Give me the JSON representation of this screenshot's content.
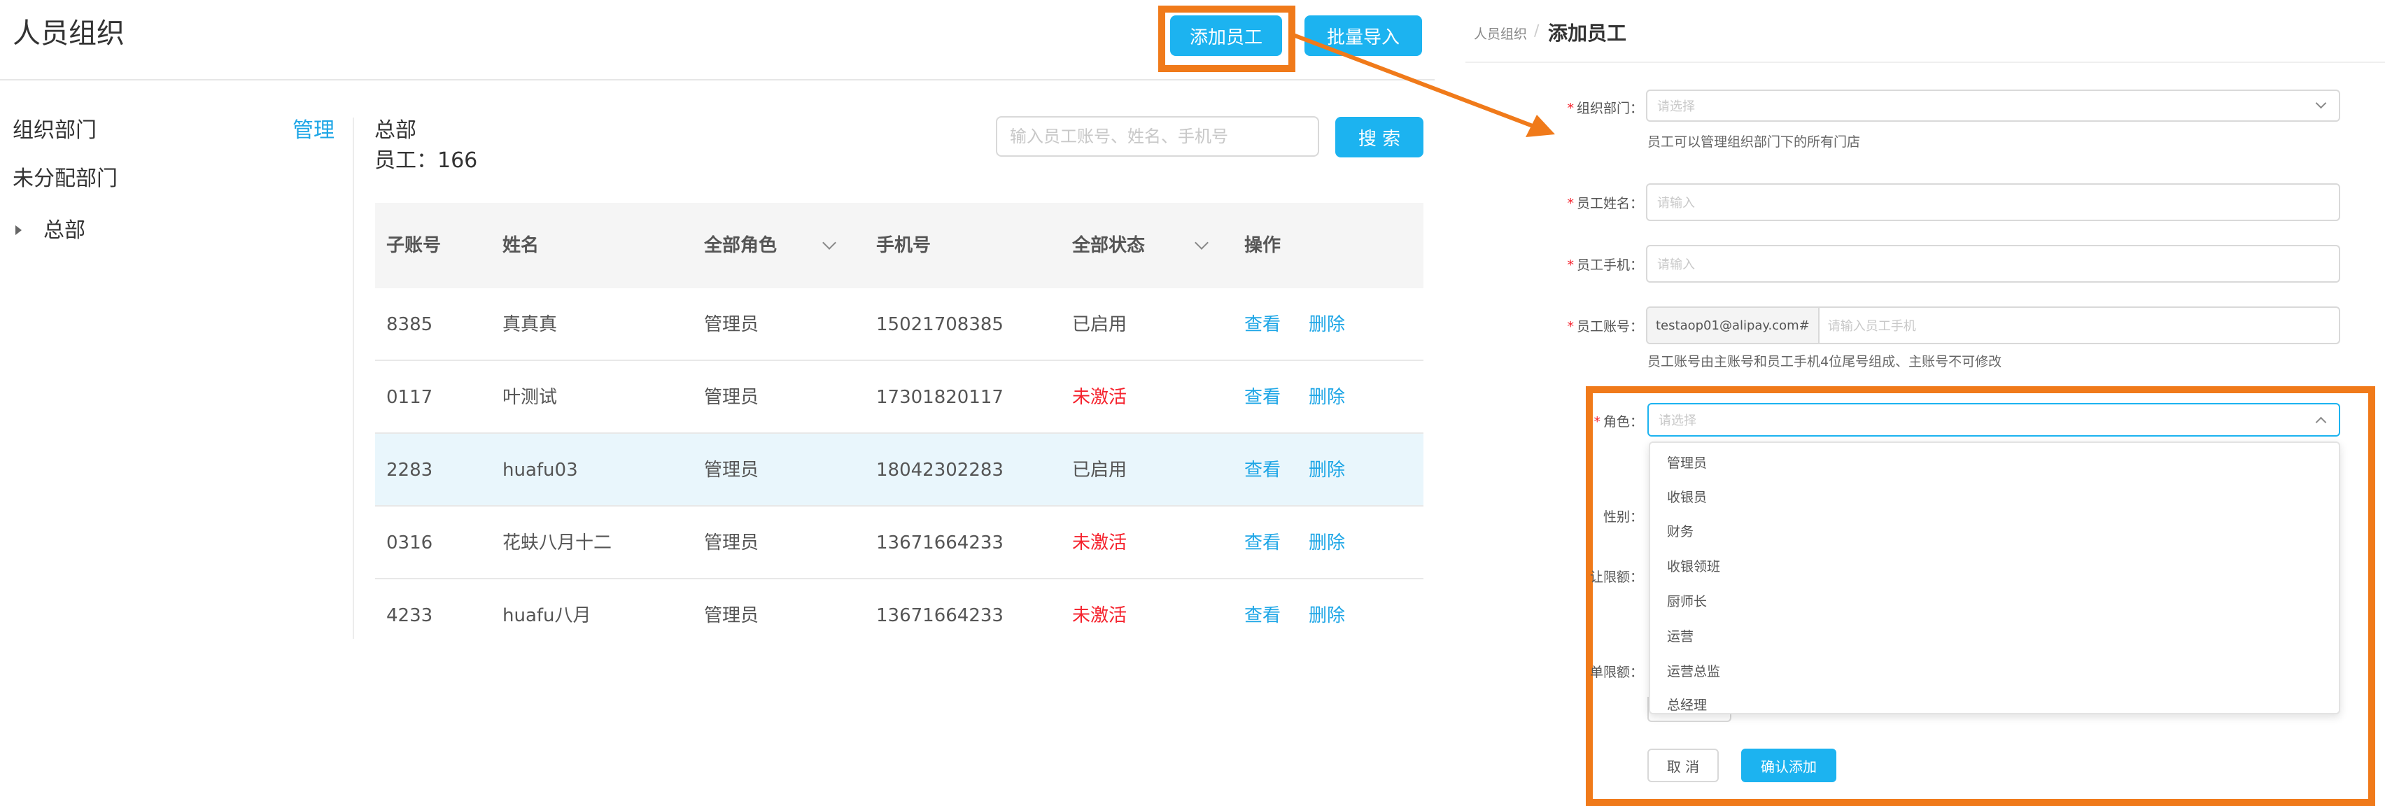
{
  "header": {
    "title": "人员组织",
    "add_btn": "添加员工",
    "import_btn": "批量导入"
  },
  "sidebar": {
    "org_label": "组织部门",
    "manage_link": "管理",
    "unassigned": "未分配部门",
    "tree_root": "总部"
  },
  "main": {
    "dept_title": "总部",
    "employee_count": "员工：166",
    "search_placeholder": "输入员工账号、姓名、手机号",
    "search_btn": "搜 索"
  },
  "table": {
    "headers": {
      "sub_account": "子账号",
      "name": "姓名",
      "role": "全部角色",
      "phone": "手机号",
      "status": "全部状态",
      "actions": "操作"
    },
    "rows": [
      {
        "sub_account": "8385",
        "name": "真真真",
        "role": "管理员",
        "phone": "15021708385",
        "status": "已启用",
        "view": "查看",
        "delete": "删除"
      },
      {
        "sub_account": "0117",
        "name": "叶测试",
        "role": "管理员",
        "phone": "17301820117",
        "status": "未激活",
        "view": "查看",
        "delete": "删除"
      },
      {
        "sub_account": "2283",
        "name": "huafu03",
        "role": "管理员",
        "phone": "18042302283",
        "status": "已启用",
        "view": "查看",
        "delete": "删除"
      },
      {
        "sub_account": "0316",
        "name": "花蚨八月十二",
        "role": "管理员",
        "phone": "13671664233",
        "status": "未激活",
        "view": "查看",
        "delete": "删除"
      },
      {
        "sub_account": "4233",
        "name": "huafu八月",
        "role": "管理员",
        "phone": "13671664233",
        "status": "未激活",
        "view": "查看",
        "delete": "删除"
      }
    ]
  },
  "form": {
    "breadcrumb_parent": "人员组织",
    "breadcrumb_sep": "/",
    "breadcrumb_current": "添加员工",
    "dept": {
      "label": "组织部门：",
      "placeholder": "请选择",
      "hint": "员工可以管理组织部门下的所有门店"
    },
    "name": {
      "label": "员工姓名：",
      "placeholder": "请输入"
    },
    "phone": {
      "label": "员工手机：",
      "placeholder": "请输入"
    },
    "account": {
      "label": "员工账号：",
      "prefix": "testaop01@alipay.com#",
      "placeholder": "请输入员工手机",
      "hint": "员工账号由主账号和员工手机4位尾号组成、主账号不可修改"
    },
    "role": {
      "label": "角色：",
      "placeholder": "请选择"
    },
    "gender": {
      "label": "性别："
    },
    "discount_limit": {
      "label": "让限额："
    },
    "free_limit": {
      "label": "单限额："
    },
    "role_options": [
      "管理员",
      "收银员",
      "财务",
      "收银领班",
      "厨师长",
      "运营",
      "运营总监",
      "总经理"
    ],
    "cancel_btn": "取 消",
    "confirm_btn": "确认添加"
  },
  "colors": {
    "accent": "#1cb3f0",
    "highlight": "#f07a1a",
    "danger": "#f5222d",
    "link": "#1ea6e6"
  }
}
